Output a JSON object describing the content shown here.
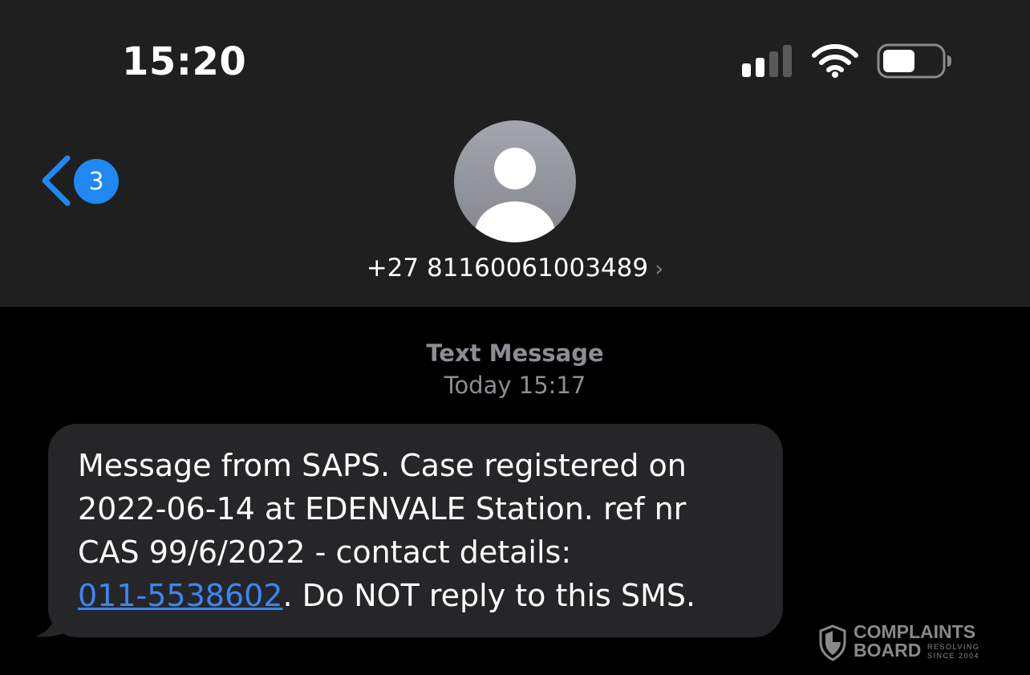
{
  "status_bar": {
    "time": "15:20",
    "signal_bars_active": 2,
    "signal_bars_total": 4,
    "wifi_icon": "wifi-icon",
    "battery_level": 0.55
  },
  "header": {
    "back_badge_count": "3",
    "contact_number": "+27 81160061003489",
    "contact_chevron": "›",
    "avatar_icon": "person-placeholder-icon"
  },
  "thread": {
    "label": "Text Message",
    "timestamp": "Today 15:17"
  },
  "message": {
    "line1": "Message from SAPS. Case registered on",
    "line2": "2022-06-14 at EDENVALE Station. ref nr",
    "line3": "CAS 99/6/2022 - contact details:",
    "link": "011-5538602",
    "line4_rest": ". Do NOT reply to this SMS."
  },
  "watermark": {
    "brand_top": "COMPLAINTS",
    "brand_bottom": "BOARD",
    "tagline_top": "RESOLVING",
    "tagline_bottom": "SINCE 2004"
  },
  "colors": {
    "accent": "#1f88f2",
    "link": "#3b86f5",
    "header_bg": "#1f1f1f",
    "bubble_bg": "#262628",
    "meta_text": "#8d8d93"
  }
}
